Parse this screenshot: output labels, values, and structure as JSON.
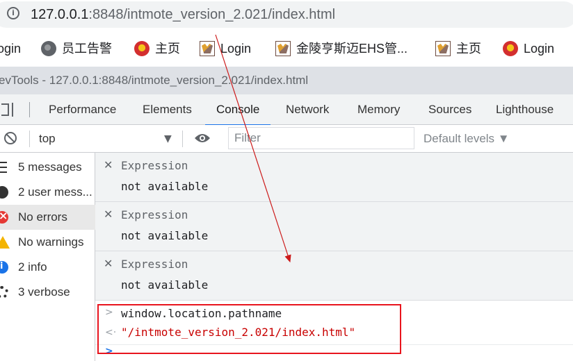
{
  "address_bar": {
    "host": "127.0.0.1",
    "path": ":8848/intmote_version_2.021/index.html"
  },
  "bookmarks": [
    {
      "label": "ogin",
      "icon": "none"
    },
    {
      "label": "员工告警",
      "icon": "globe-icon"
    },
    {
      "label": "主页",
      "icon": "emblem-icon"
    },
    {
      "label": "Login",
      "icon": "tomcat-icon"
    },
    {
      "label": "金陵亨斯迈EHS管...",
      "icon": "tomcat-icon"
    },
    {
      "label": "主页",
      "icon": "tomcat-icon"
    },
    {
      "label": "Login",
      "icon": "emblem-icon"
    }
  ],
  "devtools": {
    "title": "evTools - 127.0.0.1:8848/intmote_version_2.021/index.html",
    "tabs": [
      "Performance",
      "Elements",
      "Console",
      "Network",
      "Memory",
      "Sources",
      "Lighthouse"
    ],
    "active_tab": "Console"
  },
  "toolbar": {
    "context": "top",
    "context_arrow": "▼",
    "filter_placeholder": "Filter",
    "levels": "Default levels ▼"
  },
  "sidebar": {
    "items": [
      {
        "label": "5 messages",
        "icon": "list-icon"
      },
      {
        "label": "2 user mess...",
        "icon": "user-icon"
      },
      {
        "label": "No errors",
        "icon": "error-icon"
      },
      {
        "label": "No warnings",
        "icon": "warning-icon"
      },
      {
        "label": "2 info",
        "icon": "info-icon"
      },
      {
        "label": "3 verbose",
        "icon": "gear-icon"
      }
    ],
    "selected": "No errors"
  },
  "expressions": [
    {
      "name": "Expression",
      "value": "not available"
    },
    {
      "name": "Expression",
      "value": "not available"
    },
    {
      "name": "Expression",
      "value": "not available"
    }
  ],
  "console": {
    "input_prefix": ">",
    "input": "window.location.pathname",
    "output_prefix": "<·",
    "output": "\"/intmote_version_2.021/index.html\"",
    "prompt": ">"
  },
  "annotation": {
    "box_color": "#e8141d",
    "arrow_color": "#cc1a1a"
  }
}
